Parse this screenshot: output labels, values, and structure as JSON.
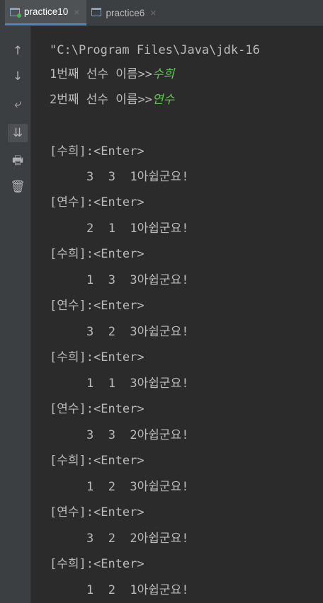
{
  "tabs": [
    {
      "label": "practice10",
      "close": "×",
      "active": true
    },
    {
      "label": "practice6",
      "close": "×",
      "active": false
    }
  ],
  "gutter": {
    "up": "↑",
    "down": "↓",
    "wrap": "⤶",
    "scroll": "⇊",
    "print": "🖶",
    "trash": "🗑"
  },
  "console": {
    "command": "\"C:\\Program Files\\Java\\jdk-16",
    "prompt1": "1번째 선수 이름>>",
    "input1": "수희",
    "prompt2": "2번째 선수 이름>>",
    "input2": "연수",
    "lines": [
      "[수희]:<Enter>",
      "3  3  1아쉽군요!",
      "[연수]:<Enter>",
      "2  1  1아쉽군요!",
      "[수희]:<Enter>",
      "1  3  3아쉽군요!",
      "[연수]:<Enter>",
      "3  2  3아쉽군요!",
      "[수희]:<Enter>",
      "1  1  3아쉽군요!",
      "[연수]:<Enter>",
      "3  3  2아쉽군요!",
      "[수희]:<Enter>",
      "1  2  3아쉽군요!",
      "[연수]:<Enter>",
      "3  2  2아쉽군요!",
      "[수희]:<Enter>",
      "1  2  1아쉽군요!"
    ]
  },
  "colors": {
    "background": "#2b2b2b",
    "text": "#bbbbbb",
    "user_input": "#61c554",
    "tab_accent": "#4a88c7"
  }
}
